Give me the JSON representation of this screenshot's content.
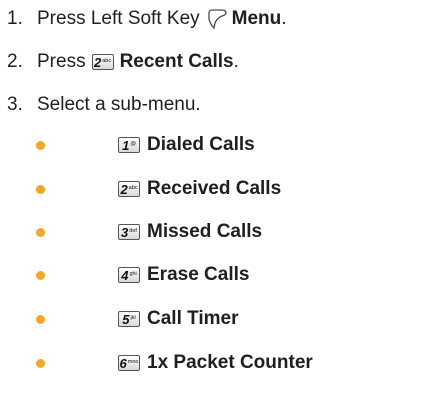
{
  "steps": [
    {
      "number": "1.",
      "text": "Press Left Soft Key",
      "bold": "Menu",
      "suffix": "."
    },
    {
      "number": "2.",
      "text": "Press",
      "key": {
        "digit": "2",
        "letters": "abc"
      },
      "bold": "Recent Calls",
      "suffix": "."
    },
    {
      "number": "3.",
      "text": "Select a sub-menu."
    }
  ],
  "submenu": [
    {
      "digit": "1",
      "letters": "@",
      "label": "Dialed Calls"
    },
    {
      "digit": "2",
      "letters": "abc",
      "label": "Received Calls"
    },
    {
      "digit": "3",
      "letters": "def",
      "label": "Missed Calls"
    },
    {
      "digit": "4",
      "letters": "ghi",
      "label": "Erase Calls"
    },
    {
      "digit": "5",
      "letters": "jkl",
      "label": "Call Timer"
    },
    {
      "digit": "6",
      "letters": "mno",
      "label": "1x Packet Counter"
    }
  ],
  "colors": {
    "bullet": "#f5a623",
    "text": "#1f1f1f"
  },
  "icons": {
    "left_soft_key": "left-soft-key-icon"
  }
}
